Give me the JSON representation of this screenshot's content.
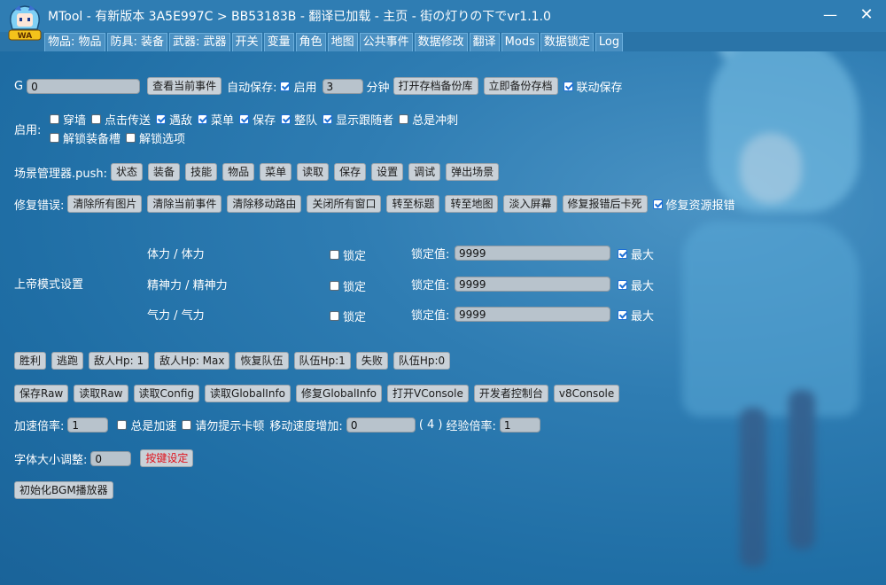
{
  "window": {
    "title": "MTool - 有新版本 3A5E997C > BB53183B - 翻译已加载 - 主页 - 街の灯りの下でvr1.1.0",
    "minimize": "—",
    "close": "✕"
  },
  "app_icon_text": "WA",
  "tabs": [
    "物品: 物品",
    "防具: 装备",
    "武器: 武器",
    "开关",
    "变量",
    "角色",
    "地图",
    "公共事件",
    "数据修改",
    "翻译",
    "Mods",
    "数据锁定",
    "Log"
  ],
  "gold": {
    "label": "G",
    "value": "0",
    "check_event": "查看当前事件",
    "autosave_label": "自动保存:",
    "enable_label": "启用",
    "enable_checked": true,
    "minutes_value": "3",
    "minutes_unit": "分钟",
    "open_backup": "打开存档备份库",
    "backup_now": "立即备份存档",
    "linked_save": "联动保存",
    "linked_save_checked": true
  },
  "enable": {
    "label": "启用:",
    "options_row1": [
      {
        "label": "穿墙",
        "checked": false
      },
      {
        "label": "点击传送",
        "checked": false
      },
      {
        "label": "遇敌",
        "checked": true
      },
      {
        "label": "菜单",
        "checked": true
      },
      {
        "label": "保存",
        "checked": true
      },
      {
        "label": "整队",
        "checked": true
      },
      {
        "label": "显示跟随者",
        "checked": true
      },
      {
        "label": "总是冲刺",
        "checked": false
      }
    ],
    "options_row2": [
      {
        "label": "解锁装备槽",
        "checked": false
      },
      {
        "label": "解锁选项",
        "checked": false
      }
    ]
  },
  "scene": {
    "label": "场景管理器.push:",
    "buttons": [
      "状态",
      "装备",
      "技能",
      "物品",
      "菜单",
      "读取",
      "保存",
      "设置",
      "调试",
      "弹出场景"
    ]
  },
  "fix": {
    "label": "修复错误:",
    "buttons": [
      "清除所有图片",
      "清除当前事件",
      "清除移动路由",
      "关闭所有窗口",
      "转至标题",
      "转至地图",
      "淡入屏幕",
      "修复报错后卡死"
    ],
    "resource_fix": "修复资源报错",
    "resource_fix_checked": true
  },
  "god": {
    "label": "上帝模式设置",
    "lock_label": "锁定",
    "lock_value_label": "锁定值:",
    "max_label": "最大",
    "stats": [
      {
        "name": "体力 / 体力",
        "locked": false,
        "value": "9999",
        "max": true
      },
      {
        "name": "精神力 / 精神力",
        "locked": false,
        "value": "9999",
        "max": true
      },
      {
        "name": "气力 / 气力",
        "locked": false,
        "value": "9999",
        "max": true
      }
    ]
  },
  "battle": {
    "buttons": [
      "胜利",
      "逃跑",
      "敌人Hp: 1",
      "敌人Hp: Max",
      "恢复队伍",
      "队伍Hp:1",
      "失败",
      "队伍Hp:0"
    ]
  },
  "tools": {
    "buttons": [
      "保存Raw",
      "读取Raw",
      "读取Config",
      "读取GlobalInfo",
      "修复GlobalInfo",
      "打开VConsole",
      "开发者控制台",
      "v8Console"
    ]
  },
  "speed": {
    "label": "加速倍率:",
    "value": "1",
    "always_speed": "总是加速",
    "always_speed_checked": false,
    "no_lag_hint": "请勿提示卡顿",
    "no_lag_hint_checked": false,
    "move_label": "移动速度增加:",
    "move_value": "0",
    "move_current": "( 4 )",
    "exp_label": "经验倍率:",
    "exp_value": "1"
  },
  "font": {
    "label": "字体大小调整:",
    "value": "0",
    "keybind": "按键设定"
  },
  "bgm": {
    "init": "初始化BGM播放器"
  }
}
